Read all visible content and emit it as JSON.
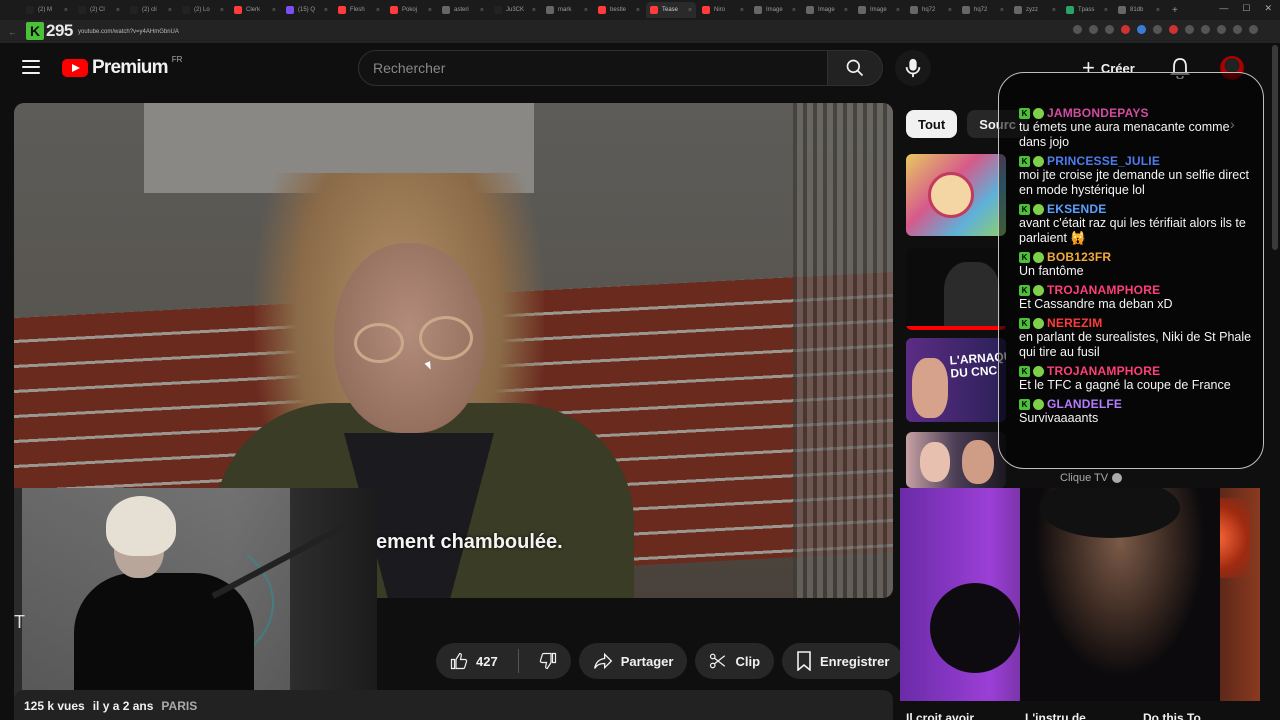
{
  "browser": {
    "tabs": [
      {
        "label": "(2) M",
        "color": "#222"
      },
      {
        "label": "(2) Cl",
        "color": "#222"
      },
      {
        "label": "(2) cli",
        "color": "#222"
      },
      {
        "label": "(2) Lo",
        "color": "#222"
      },
      {
        "label": "Clerk",
        "color": "#ff3b3b"
      },
      {
        "label": "(15) Q",
        "color": "#7b4ff0"
      },
      {
        "label": "Flesh",
        "color": "#ff3b3b"
      },
      {
        "label": "Pokoj",
        "color": "#ff3b3b"
      },
      {
        "label": "asteri",
        "color": "#666"
      },
      {
        "label": "Ju3CK",
        "color": "#222"
      },
      {
        "label": "mark",
        "color": "#666"
      },
      {
        "label": "bestle",
        "color": "#ff3b3b"
      },
      {
        "label": "Tease",
        "color": "#ff3b3b"
      },
      {
        "label": "Niro",
        "color": "#ff3b3b"
      },
      {
        "label": "Image",
        "color": "#666"
      },
      {
        "label": "Image",
        "color": "#666"
      },
      {
        "label": "Image",
        "color": "#666"
      },
      {
        "label": "hq72",
        "color": "#666"
      },
      {
        "label": "hq72",
        "color": "#666"
      },
      {
        "label": "zyzz",
        "color": "#666"
      },
      {
        "label": "Tpass",
        "color": "#2aa36b"
      },
      {
        "label": "81db",
        "color": "#666"
      }
    ],
    "active_tab_index": 12,
    "url": "youtube.com/watch?v=y4AHmGbnUA",
    "kick_badge": {
      "letter": "K",
      "count": "295"
    }
  },
  "header": {
    "logo_text": "Premium",
    "logo_region": "FR",
    "search_placeholder": "Rechercher",
    "create_label": "Créer"
  },
  "video": {
    "subtitle": "ement chamboulée.",
    "title_stub": "T",
    "likes": "427",
    "share_label": "Partager",
    "clip_label": "Clip",
    "save_label": "Enregistrer",
    "views": "125 k vues",
    "age": "il y a 2 ans",
    "location": "PARIS"
  },
  "sidebar": {
    "chips": [
      "Tout",
      "Sourc"
    ],
    "active_chip": 0,
    "channel_name": "Clique TV",
    "bottom_titles": [
      "Il croit avoir",
      "L'instru de",
      "Do this To"
    ]
  },
  "chat": {
    "messages": [
      {
        "user": "JAMBONDEPAYS",
        "color": "#d24da0",
        "text": "tu émets une aura menacante comme dans jojo"
      },
      {
        "user": "PRINCESSE_JULIE",
        "color": "#4d7cf0",
        "text": "moi jte croise jte demande un selfie direct en mode hystérique lol"
      },
      {
        "user": "EKSENDE",
        "color": "#5aa0ff",
        "text": "avant c'était raz qui les térifiait alors ils te parlaient 🙀"
      },
      {
        "user": "BOB123FR",
        "color": "#f2a93a",
        "text": "Un fantôme"
      },
      {
        "user": "TROJANAMPHORE",
        "color": "#ff3f7a",
        "text": "Et Cassandre ma deban xD"
      },
      {
        "user": "NEREZIM",
        "color": "#ff3b3b",
        "text": "en parlant de surealistes, Niki de St Phale qui tire au fusil"
      },
      {
        "user": "TROJANAMPHORE",
        "color": "#ff3f7a",
        "text": "Et le TFC a gagné la coupe de France"
      },
      {
        "user": "GLANDELFE",
        "color": "#b57cff",
        "text": "Survivaaaants"
      }
    ]
  },
  "colors": {
    "bg": "#0f0f0f",
    "youtube_red": "#ff0000",
    "kick_green": "#4bc13a",
    "pill_bg": "#272727"
  }
}
